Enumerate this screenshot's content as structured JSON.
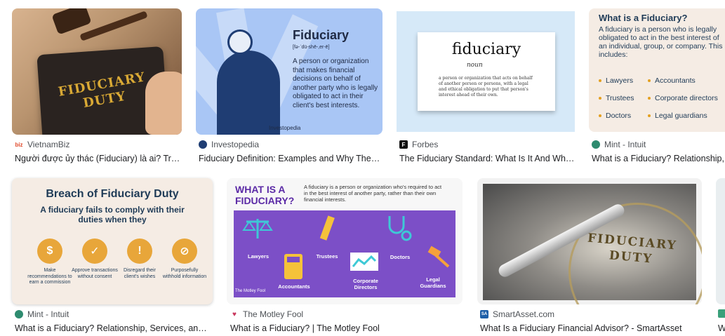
{
  "results": [
    {
      "source": "VietnamBiz",
      "title": "Người được ủy thác (Fiduciary) là ai? Trá...",
      "favicon": "biz",
      "favicon_color": "#e04a2b",
      "image_text": {
        "line1": "FIDUCIARY",
        "line2": "DUTY"
      }
    },
    {
      "source": "Investopedia",
      "title": "Fiduciary Definition: Examples and Why They ...",
      "favicon": "",
      "favicon_color": "#1f3d73",
      "image_text": {
        "heading": "Fiduciary",
        "pronunciation": "[fə-ˈdü-shē-,er-ē]",
        "description": "A person or organization that makes financial decisions on behalf of another party who is legally obligated to act in their client's best interests.",
        "brand": "Investopedia"
      }
    },
    {
      "source": "Forbes",
      "title": "The Fiduciary Standard: What Is It And Why...",
      "favicon": "F",
      "favicon_color": "#111111",
      "image_text": {
        "word": "fiduciary",
        "pos": "noun",
        "definition": "a person or organization that acts on behalf of another person or persons, with a legal and ethical obligation to put that person's interest ahead of their own."
      }
    },
    {
      "source": "Mint - Intuit",
      "title": "What is a Fiduciary? Relationship, Services, and ...",
      "favicon": "",
      "favicon_color": "#2e8b6f",
      "image_text": {
        "heading": "What is a Fiduciary?",
        "description": "A fiduciary is a person who is legally obligated to act in the best interest of an individual, group, or company. This includes:",
        "items": [
          "Lawyers",
          "Accountants",
          "Trustees",
          "Corporate directors",
          "Doctors",
          "Legal guardians"
        ]
      }
    },
    {
      "source": "Mint - Intuit",
      "title": "What is a Fiduciary? Relationship, Services, and ...",
      "favicon": "",
      "favicon_color": "#2e8b6f",
      "image_text": {
        "heading": "Breach of Fiduciary Duty",
        "sub": "A fiduciary fails to comply with their duties when they",
        "items": [
          "Make recommendations to earn a commission",
          "Approve transactions without consent",
          "Disregard their client's wishes",
          "Purposefully withhold information"
        ]
      }
    },
    {
      "source": "The Motley Fool",
      "title": "What is a Fiduciary? | The Motley Fool",
      "favicon": "",
      "favicon_color": "#c8365c",
      "image_text": {
        "heading_line1": "WHAT IS A",
        "heading_line2": "FIDUCIARY?",
        "description": "A fiduciary is a person or organization who's required to act in the best interest of another party, rather than their own financial interests.",
        "labels": [
          "Lawyers",
          "Trustees",
          "Doctors",
          "Accountants",
          "Corporate Directors",
          "Legal Guardians"
        ],
        "brand": "The Motley Fool"
      }
    },
    {
      "source": "SmartAsset.com",
      "title": "What Is a Fiduciary Financial Advisor? - SmartAsset",
      "favicon": "SA",
      "favicon_color": "#1e5fa8",
      "image_text": {
        "line1": "FIDUCIARY",
        "line2": "DUTY"
      }
    },
    {
      "source": "",
      "title": "W",
      "favicon": "",
      "favicon_color": "#3aa07a"
    }
  ]
}
